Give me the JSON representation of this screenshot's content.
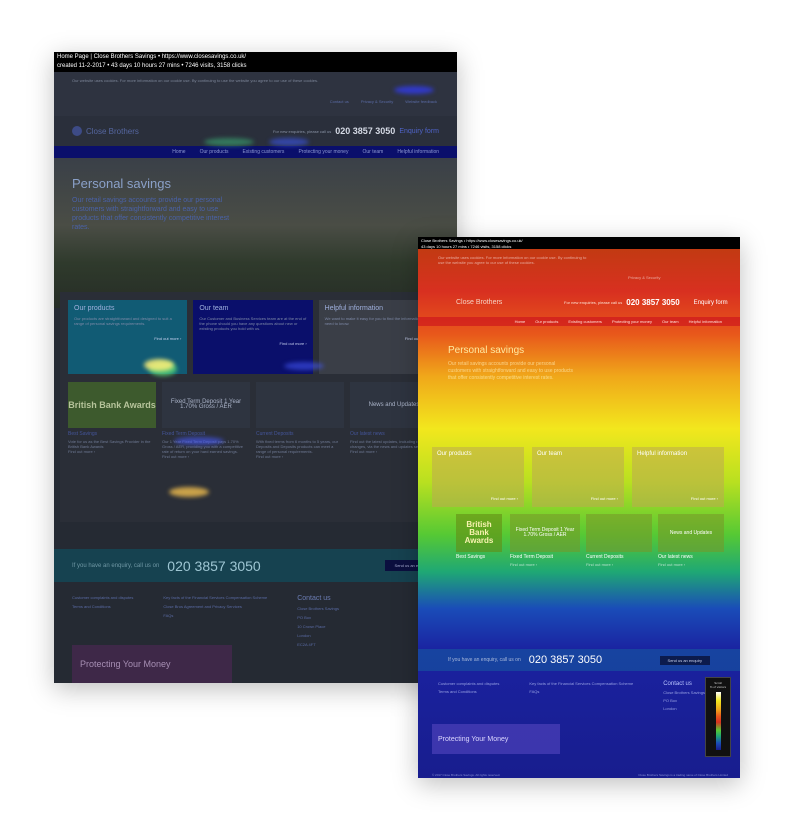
{
  "captions": {
    "left": {
      "line1": "Home Page | Close Brothers Savings  •  https://www.closesavings.co.uk/",
      "line2": "created 11-2-2017  •  43 days 10 hours 27 mins  •  7246 visits, 3158 clicks"
    },
    "right": {
      "line1": "Close Brothers Savings  •  https://www.closesavings.co.uk/",
      "line2": "43 days 10 hours 27 mins  •  7246 visits, 3158 clicks"
    }
  },
  "site": {
    "cookie_notice": "Our website uses cookies. For more information on our cookie use. By continuing to use the website you agree to our use of these cookies.",
    "utility_links": [
      "Contact us",
      "Privacy & Security",
      "Website feedback"
    ],
    "logo": "Close Brothers",
    "logo_sub": "Savings",
    "phone_prompt": "For new enquiries, please call us",
    "phone": "020 3857 3050",
    "enquiry": "Enquiry form",
    "nav": [
      "Home",
      "Our products",
      "Existing customers",
      "Protecting your money",
      "Our team",
      "Helpful information"
    ],
    "hero_title": "Personal savings",
    "hero_text": "Our retail savings accounts provide our personal customers with straightforward and easy to use products that offer consistently competitive interest rates.",
    "cards": [
      {
        "title": "Our products",
        "text": "Our products are straightforward and designed to suit a range of personal savings requirements.",
        "link": "Find out more ›"
      },
      {
        "title": "Our team",
        "text": "Our Customer and Business Services team are at the end of the phone should you have any questions about new or existing products you hold with us.",
        "link": "Find out more ›"
      },
      {
        "title": "Helpful information",
        "text": "We want to make it easy for you to find the information you need to know.",
        "link": "Find out more ›"
      }
    ],
    "products": [
      {
        "image_text": "British Bank Awards",
        "title": "Best Savings",
        "text": "Vote for us as the Best Savings Provider in the British Bank Awards",
        "link": "Find out more ›"
      },
      {
        "image_text": "Fixed Term Deposit 1 Year 1.70% Gross / AER",
        "title": "Fixed Term Deposit",
        "text": "Our 1 Year Fixed Term Deposit pays 1.70% Gross / AER, providing you with a competitive rate of return on your hard earned savings.",
        "link": "Find out more ›"
      },
      {
        "image_text": "",
        "title": "Current Deposits",
        "text": "With fixed terms from 6 months to 5 years, our Deposits and Deposits products can meet a range of personal requirements.",
        "link": "Find out more ›"
      },
      {
        "image_text": "News and Updates",
        "title": "Our latest news",
        "text": "Find out the latest updates, including rate changes, via the news and updates section.",
        "link": "Find out more ›"
      }
    ],
    "cta_text": "If you have an enquiry, call us on",
    "cta_phone": "020 3857 3050",
    "cta_button": "Send us an enquiry",
    "footer_links_1": [
      "Customer complaints and disputes",
      "Terms and Conditions"
    ],
    "footer_links_2": [
      "Key facts of the Financial Services Compensation Scheme",
      "Close Bros Agreement and Privacy Services",
      "FAQs"
    ],
    "contact_title": "Contact us",
    "contact_lines": [
      "Close Brothers Savings",
      "PO Box",
      "10 Crown Place",
      "London",
      "EC2A 4FT"
    ],
    "protect": "Protecting Your Money",
    "fscs": "fscs",
    "footer_bottom_left": "© 2017 Close Brothers Savings. All rights reserved.",
    "footer_bottom_right": "Close Brothers Savings is a trading name of Close Brothers Limited"
  },
  "legend": {
    "title": "Scroll",
    "label": "% of visitors"
  },
  "colors": {
    "heat_high": "#d83020",
    "heat_mid": "#f2e71d",
    "heat_low": "#181d8e",
    "nav_blue": "#0a0f6b"
  }
}
